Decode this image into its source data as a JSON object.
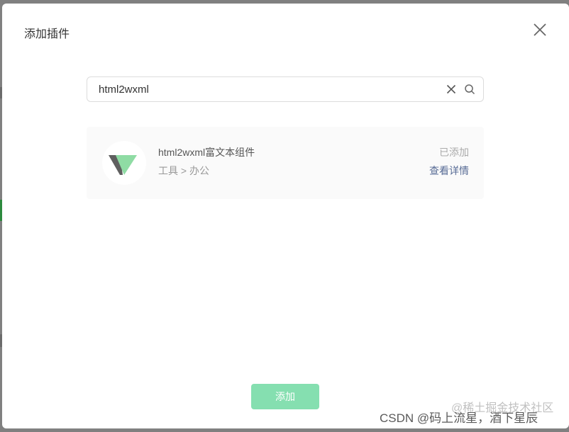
{
  "dialog": {
    "title": "添加插件",
    "close_icon": "close-icon"
  },
  "search": {
    "value": "html2wxml",
    "clear_icon": "clear-icon",
    "search_icon": "search-icon"
  },
  "plugin": {
    "name": "html2wxml富文本组件",
    "category": "工具 > 办公",
    "status": "已添加",
    "detail_link": "查看详情",
    "logo_icon": "plugin-logo-icon",
    "logo_colors": {
      "dark": "#5f5f5f",
      "green": "#8fdca4"
    }
  },
  "footer": {
    "add_label": "添加",
    "add_color": "#85dfb0"
  },
  "watermark": {
    "primary": "CSDN @码上流星，酒下星辰",
    "secondary": "@稀土掘金技术社区"
  }
}
